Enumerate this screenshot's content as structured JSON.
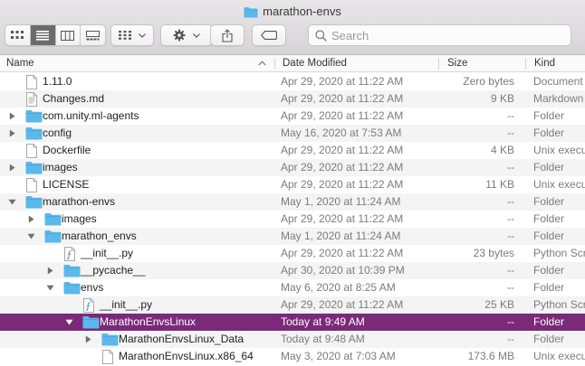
{
  "window": {
    "title": "marathon-envs"
  },
  "search": {
    "placeholder": "Search"
  },
  "columns": {
    "name": "Name",
    "date": "Date Modified",
    "size": "Size",
    "kind": "Kind"
  },
  "colors": {
    "selection": "#7a2a78",
    "folder": "#5bb8ea"
  },
  "rows": [
    {
      "name": "1.11.0",
      "date": "Apr 29, 2020 at 11:22 AM",
      "size": "Zero bytes",
      "kind": "Document",
      "icon": "doc-icon",
      "depth": 0,
      "disclosure": "none"
    },
    {
      "name": "Changes.md",
      "date": "Apr 29, 2020 at 11:22 AM",
      "size": "9 KB",
      "kind": "Markdown",
      "icon": "text-doc-icon",
      "depth": 0,
      "disclosure": "none"
    },
    {
      "name": "com.unity.ml-agents",
      "date": "Apr 29, 2020 at 11:22 AM",
      "size": "--",
      "kind": "Folder",
      "icon": "folder-icon",
      "depth": 0,
      "disclosure": "closed"
    },
    {
      "name": "config",
      "date": "May 16, 2020 at 7:53 AM",
      "size": "--",
      "kind": "Folder",
      "icon": "folder-icon",
      "depth": 0,
      "disclosure": "closed"
    },
    {
      "name": "Dockerfile",
      "date": "Apr 29, 2020 at 11:22 AM",
      "size": "4 KB",
      "kind": "Unix executable",
      "icon": "doc-icon",
      "depth": 0,
      "disclosure": "none"
    },
    {
      "name": "images",
      "date": "Apr 29, 2020 at 11:22 AM",
      "size": "--",
      "kind": "Folder",
      "icon": "folder-icon",
      "depth": 0,
      "disclosure": "closed"
    },
    {
      "name": "LICENSE",
      "date": "Apr 29, 2020 at 11:22 AM",
      "size": "11 KB",
      "kind": "Unix executable",
      "icon": "doc-icon",
      "depth": 0,
      "disclosure": "none"
    },
    {
      "name": "marathon-envs",
      "date": "May 1, 2020 at 11:24 AM",
      "size": "--",
      "kind": "Folder",
      "icon": "folder-icon",
      "depth": 0,
      "disclosure": "open"
    },
    {
      "name": "images",
      "date": "Apr 29, 2020 at 11:22 AM",
      "size": "--",
      "kind": "Folder",
      "icon": "folder-icon",
      "depth": 1,
      "disclosure": "closed"
    },
    {
      "name": "marathon_envs",
      "date": "May 1, 2020 at 11:24 AM",
      "size": "--",
      "kind": "Folder",
      "icon": "folder-icon",
      "depth": 1,
      "disclosure": "open"
    },
    {
      "name": "__init__.py",
      "date": "Apr 29, 2020 at 11:22 AM",
      "size": "23 bytes",
      "kind": "Python Script",
      "icon": "python-file-icon",
      "depth": 2,
      "disclosure": "none"
    },
    {
      "name": "__pycache__",
      "date": "Apr 30, 2020 at 10:39 PM",
      "size": "--",
      "kind": "Folder",
      "icon": "folder-icon",
      "depth": 2,
      "disclosure": "closed"
    },
    {
      "name": "envs",
      "date": "May 6, 2020 at 8:25 AM",
      "size": "--",
      "kind": "Folder",
      "icon": "folder-icon",
      "depth": 2,
      "disclosure": "open"
    },
    {
      "name": "__init__.py",
      "date": "Apr 29, 2020 at 11:22 AM",
      "size": "25 KB",
      "kind": "Python Script",
      "icon": "python-file-icon",
      "depth": 3,
      "disclosure": "none"
    },
    {
      "name": "MarathonEnvsLinux",
      "date": "Today at 9:49 AM",
      "size": "--",
      "kind": "Folder",
      "icon": "folder-icon",
      "depth": 3,
      "disclosure": "open",
      "selected": true
    },
    {
      "name": "MarathonEnvsLinux_Data",
      "date": "Today at 9:48 AM",
      "size": "--",
      "kind": "Folder",
      "icon": "folder-icon",
      "depth": 4,
      "disclosure": "closed"
    },
    {
      "name": "MarathonEnvsLinux.x86_64",
      "date": "May 3, 2020 at 7:03 AM",
      "size": "173.6 MB",
      "kind": "Unix executable",
      "icon": "doc-icon",
      "depth": 4,
      "disclosure": "none"
    }
  ]
}
